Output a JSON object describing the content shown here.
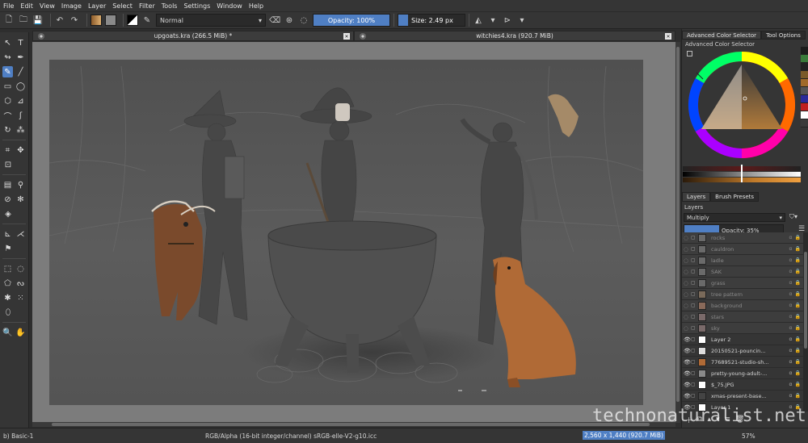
{
  "menu": [
    "File",
    "Edit",
    "View",
    "Image",
    "Layer",
    "Select",
    "Filter",
    "Tools",
    "Settings",
    "Window",
    "Help"
  ],
  "toolbar": {
    "blend_mode": "Normal",
    "opacity": "Opacity: 100%",
    "opacity_fraction": 1.0,
    "size": "Size: 2.49 px",
    "size_fraction": 0.03
  },
  "documents": [
    {
      "title": "upgoats.kra (266.5 MiB) *"
    },
    {
      "title": "witchies4.kra (920.7 MiB)"
    }
  ],
  "dock": {
    "color_tabs": [
      "Advanced Color Selector",
      "Tool Options"
    ],
    "color_panel_title": "Advanced Color Selector",
    "layer_tabs": [
      "Layers",
      "Brush Presets"
    ],
    "layers_title": "Layers",
    "layer_blend": "Multiply",
    "layer_opacity": "Opacity:  35%",
    "layer_opacity_fraction": 0.35
  },
  "layers": [
    {
      "name": "rocks",
      "dim": true,
      "flags": "α"
    },
    {
      "name": "cauldron",
      "dim": true,
      "flags": "α"
    },
    {
      "name": "ladle",
      "dim": true,
      "flags": "α"
    },
    {
      "name": "SAK",
      "dim": true,
      "flags": "α"
    },
    {
      "name": "grass",
      "dim": true,
      "flags": "α"
    },
    {
      "name": "tree pattern",
      "dim": true,
      "flags": "α"
    },
    {
      "name": "background",
      "dim": true,
      "flags": "α"
    },
    {
      "name": "stars",
      "dim": true,
      "flags": "α"
    },
    {
      "name": "sky",
      "dim": true,
      "flags": "α"
    },
    {
      "name": "Layer 2",
      "dim": false,
      "flags": "α"
    },
    {
      "name": "20150521-pouncin...",
      "dim": false,
      "flags": "α"
    },
    {
      "name": "77689521-studio-sh...",
      "dim": false,
      "flags": "α"
    },
    {
      "name": "pretty-young-adult-...",
      "dim": false,
      "flags": "α"
    },
    {
      "name": "$_75.JPG",
      "dim": false,
      "flags": "α"
    },
    {
      "name": "xmas-present-base...",
      "dim": false,
      "flags": "α"
    },
    {
      "name": "Layer 1",
      "dim": false,
      "flags": "α"
    }
  ],
  "status": {
    "brush": "b) Basic-1",
    "color_info": "RGB/Alpha (16-bit integer/channel)  sRGB-elle-V2-g10.icc",
    "dimensions": "2,560 x 1,440 (920.7 MiB)",
    "zoom": "57%"
  },
  "watermark": "technonaturalist.net",
  "colors": {
    "accent": "#4f7fc4",
    "panel": "#353535",
    "canvas_bg": "#7c7c7c",
    "image_bg": "#575757"
  }
}
